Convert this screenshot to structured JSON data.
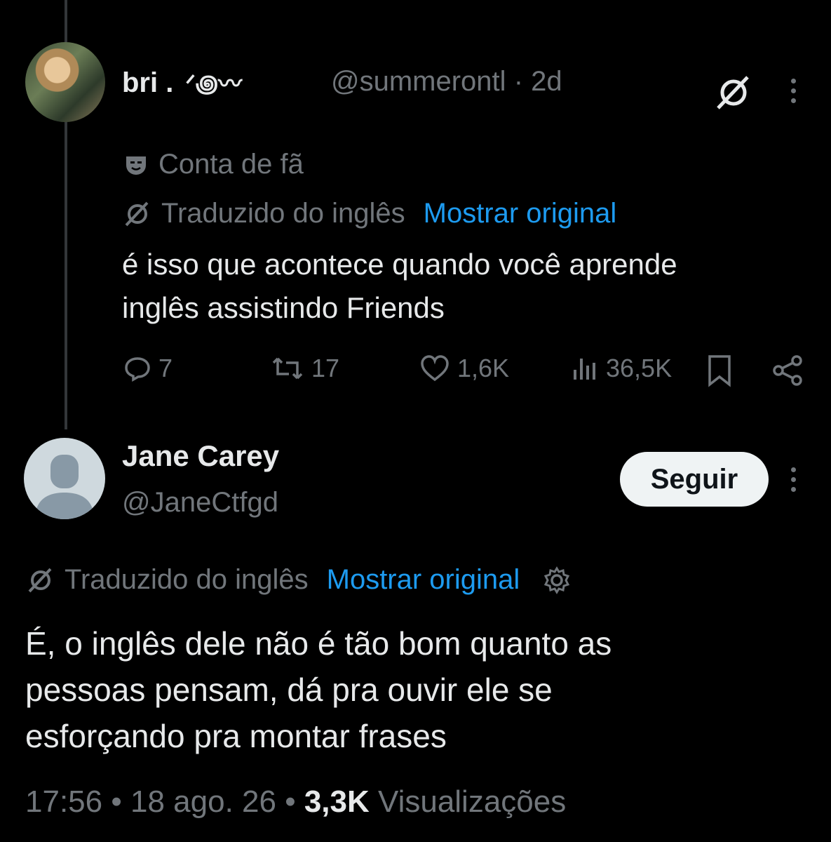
{
  "tweet1": {
    "display_name": "bri .",
    "handle": "@summerontl",
    "time": "· 2d",
    "label": "Conta de fã",
    "translated": "Traduzido do inglês",
    "show_original": "Mostrar original",
    "text_line1": "é isso que acontece quando você aprende",
    "text_line2": "inglês assistindo Friends",
    "replies": "7",
    "reposts": "17",
    "likes": "1,6K",
    "views": "36,5K"
  },
  "tweet2": {
    "display_name": "Jane Carey",
    "handle": "@JaneCtfgd",
    "follow_label": "Seguir",
    "translated": "Traduzido do inglês",
    "show_original": "Mostrar original",
    "text_line1": "É, o inglês dele não é tão bom quanto as",
    "text_line2": "pessoas pensam, dá pra ouvir ele se",
    "text_line3": "esforçando pra montar frases",
    "time": "17:56",
    "date": "18 ago. 26",
    "views_count": "3,3K",
    "views_label": "Visualizações"
  },
  "colors": {
    "background": "#000000",
    "text": "#e7e9ea",
    "secondary": "#71767b",
    "link": "#1d9bf0"
  }
}
